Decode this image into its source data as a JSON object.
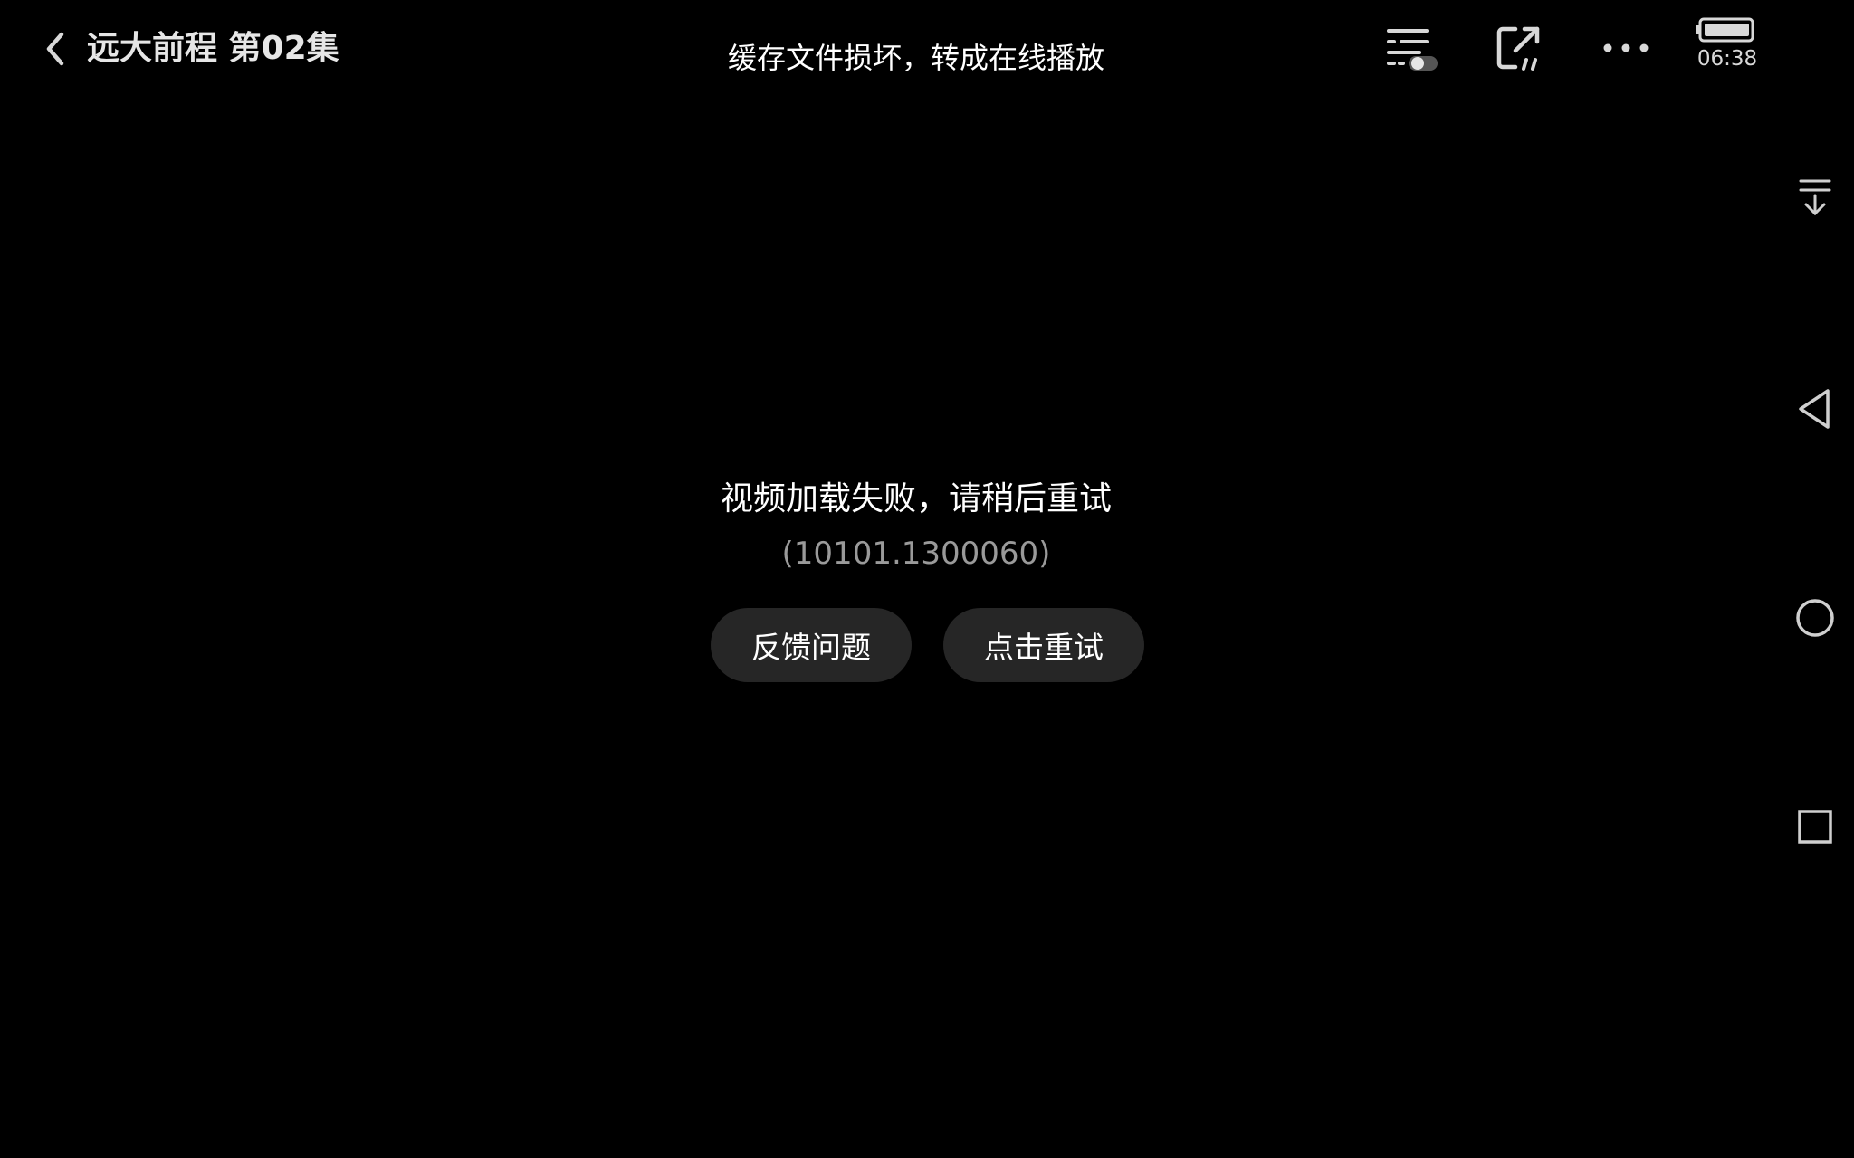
{
  "header": {
    "title": "远大前程 第02集",
    "toast": "缓存文件损坏，转成在线播放",
    "back_icon": "chevron-left-icon",
    "settings_icon": "settings-toggle-icon",
    "share_icon": "share-icon",
    "more_icon": "more-horizontal-icon"
  },
  "status": {
    "time": "06:38",
    "battery_icon": "battery-icon"
  },
  "error": {
    "message": "视频加载失败，请稍后重试",
    "code": "(10101.1300060)",
    "feedback_label": "反馈问题",
    "retry_label": "点击重试"
  },
  "navbar": {
    "collapse_icon": "pull-down-icon",
    "back_icon": "triangle-back-icon",
    "home_icon": "circle-home-icon",
    "recents_icon": "square-recents-icon"
  },
  "colors": {
    "background": "#000000",
    "button_bg": "#262626",
    "code_text": "#9a9a9a"
  }
}
